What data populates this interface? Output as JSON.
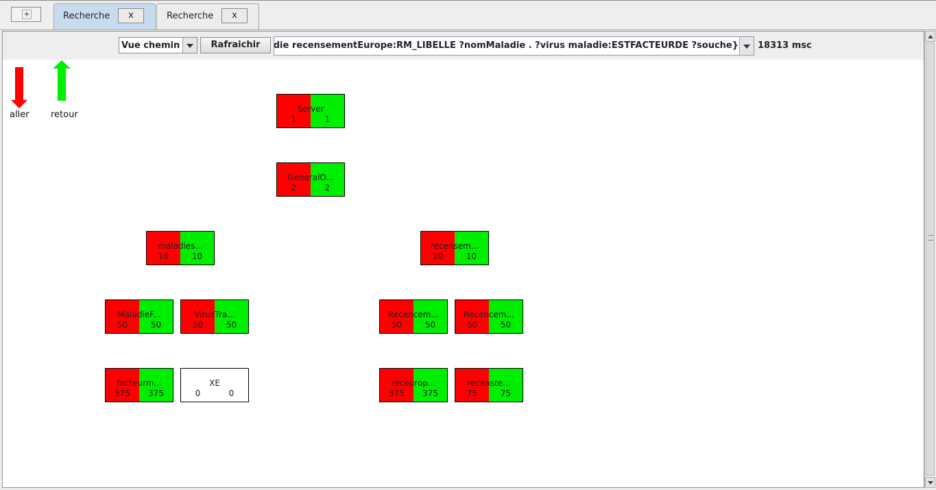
{
  "tabs": [
    {
      "label": "Recherche",
      "close": "x",
      "active": true
    },
    {
      "label": "Recherche",
      "close": "x",
      "active": false
    }
  ],
  "add_tab": "+",
  "toolbar": {
    "view_select": "Vue chemin",
    "refresh_button": "Rafraichir",
    "query": "Maladie recensementEurope:RM_LIBELLE ?nomMaladie  . ?virus maladie:ESTFACTEURDE ?souche}",
    "elapsed": "18313 msc"
  },
  "legend": {
    "go_label": "aller",
    "return_label": "retour",
    "go_color": "#ff0000",
    "return_color": "#00ee00"
  },
  "nodes": [
    {
      "name": "Server",
      "left": "1",
      "right": "1"
    },
    {
      "name": "GeneralO...",
      "left": "2",
      "right": "2"
    },
    {
      "name": "maladies...",
      "left": "10",
      "right": "10"
    },
    {
      "name": "recensem...",
      "left": "10",
      "right": "10"
    },
    {
      "name": "MaladieF...",
      "left": "50",
      "right": "50"
    },
    {
      "name": "VirusTra...",
      "left": "50",
      "right": "50"
    },
    {
      "name": "Recencem...",
      "left": "50",
      "right": "50"
    },
    {
      "name": "Recencem...",
      "left": "50",
      "right": "50"
    },
    {
      "name": "facteurm...",
      "left": "375",
      "right": "375"
    },
    {
      "name": "XE",
      "left": "0",
      "right": "0"
    },
    {
      "name": "receurop...",
      "left": "375",
      "right": "375"
    },
    {
      "name": "receaste...",
      "left": "75",
      "right": "75"
    }
  ]
}
